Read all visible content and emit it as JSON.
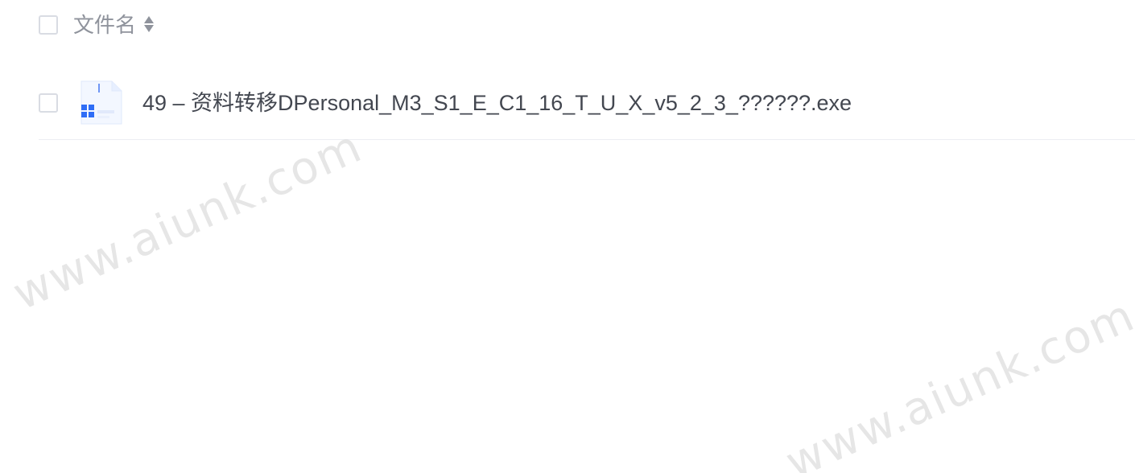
{
  "file_list": {
    "header": {
      "filename_label": "文件名"
    },
    "files": [
      {
        "name": "49 – 资料转移DPersonal_M3_S1_E_C1_16_T_U_X_v5_2_3_??????.exe",
        "icon": "windows-exe-file-icon"
      }
    ]
  },
  "watermarks": [
    "www.aiunk.com",
    "www.aiunk.com"
  ],
  "colors": {
    "header_text": "#8f939c",
    "file_text": "#434750",
    "checkbox_border": "#d9dce3",
    "divider": "#eceef2",
    "windows_blue": "#2f6df6"
  }
}
